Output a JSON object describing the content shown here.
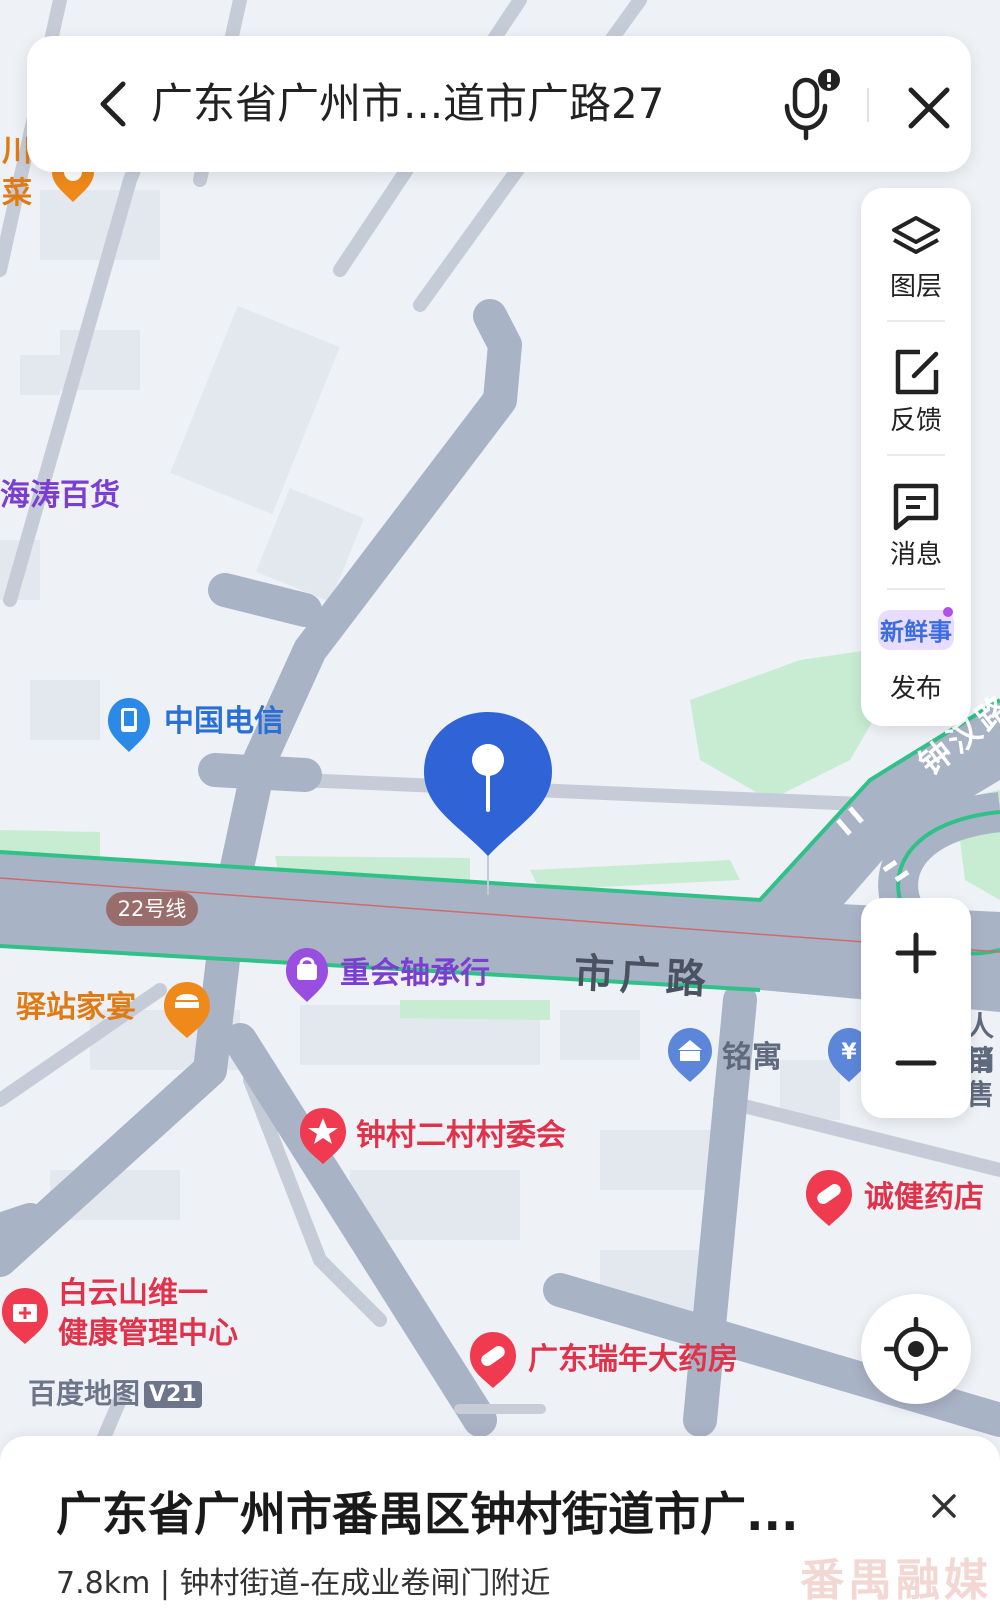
{
  "search": {
    "query": "广东省广州市...道市广路27"
  },
  "side_panel": [
    {
      "label": "图层",
      "icon": "layers-icon"
    },
    {
      "label": "反馈",
      "icon": "feedback-edit-icon"
    },
    {
      "label": "消息",
      "icon": "message-icon"
    },
    {
      "label": "发布",
      "icon": "news-badge-icon",
      "badge": "新鲜事"
    }
  ],
  "zoom": {
    "in": "+",
    "out": "−"
  },
  "map": {
    "road_label": "市广路",
    "road_label_ne": "钟汉路",
    "line_badge": "22号线",
    "pois": [
      {
        "name": "海涛百货",
        "color": "purple"
      },
      {
        "name": "中国电信",
        "color": "blue"
      },
      {
        "name": "重会轴承行",
        "color": "purple"
      },
      {
        "name": "驿站家宴",
        "color": "orange"
      },
      {
        "name": "铭寓",
        "color": "gray"
      },
      {
        "name": "钟村二村村委会",
        "color": "red"
      },
      {
        "name": "诚健药店",
        "color": "red"
      },
      {
        "name": "白云山维一",
        "color": "red"
      },
      {
        "name": "健康管理中心",
        "color": "red"
      },
      {
        "name": "广东瑞年大药房",
        "color": "red"
      }
    ],
    "edge_fragments": {
      "top_left_1": "川",
      "top_left_2": "菜",
      "right_1": "人目",
      "right_2": "销售"
    },
    "logo": {
      "name": "百度地图",
      "version": "V21"
    }
  },
  "result": {
    "title": "广东省广州市番禺区钟村街道市广...",
    "distance": "7.8km",
    "separator": "|",
    "description": "钟村街道-在成业卷闸门附近",
    "watermark": "番禺融媒"
  },
  "colors": {
    "pin": "#2f63d6",
    "road": "#a9b3c6",
    "green": "#c7ecd2",
    "route": "#2fc187"
  }
}
